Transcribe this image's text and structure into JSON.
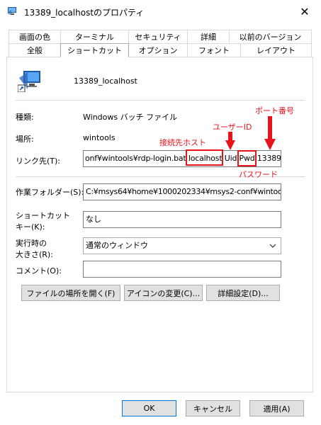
{
  "window": {
    "title": "13389_localhostのプロパティ",
    "close_glyph": "✕"
  },
  "tabs_top": [
    "画面の色",
    "ターミナル",
    "セキュリティ",
    "詳細",
    "以前のバージョン"
  ],
  "tabs_bottom": [
    "全般",
    "ショートカット",
    "オプション",
    "フォント",
    "レイアウト"
  ],
  "shortcut": {
    "name": "13389_localhost",
    "type_label": "種類:",
    "type_value": "Windows バッチ ファイル",
    "location_label": "場所:",
    "location_value": "wintools",
    "target_label": "リンク先(T):",
    "target_parts": {
      "prefix": "onf¥wintools¥rdp-login.bat ",
      "host": "localhost",
      "uid": " Uid ",
      "pwd": "Pwd",
      "port": " 13389"
    },
    "workdir_label": "作業フォルダー(S):",
    "workdir_value": "C:¥msys64¥home¥1000202334¥msys2-conf¥wintools",
    "hotkey_label_1": "ショートカット",
    "hotkey_label_2": "キー(K):",
    "hotkey_value": "なし",
    "run_label_1": "実行時の",
    "run_label_2": "大きさ(R):",
    "run_value": "通常のウィンドウ",
    "comment_label": "コメント(O):",
    "comment_value": ""
  },
  "buttons": {
    "open_location": "ファイルの場所を開く(F)",
    "change_icon": "アイコンの変更(C)...",
    "advanced": "詳細設定(D)...",
    "ok": "OK",
    "cancel": "キャンセル",
    "apply": "適用(A)"
  },
  "annotations": {
    "port": "ポート番号",
    "user_id": "ユーザーID",
    "host": "接続先ホスト",
    "password": "パスワード"
  },
  "colors": {
    "annotation_red": "#e8141b",
    "accent_blue": "#0078d7"
  }
}
